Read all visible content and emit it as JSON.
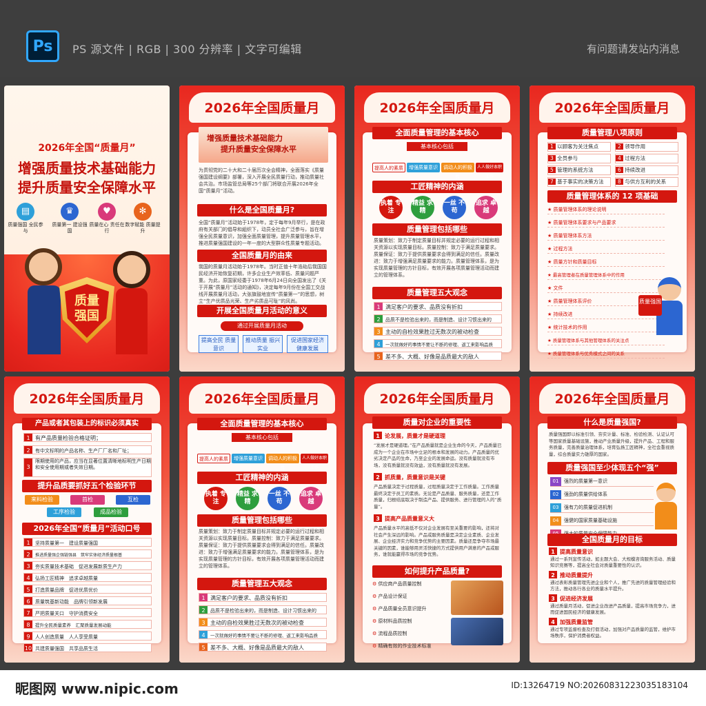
{
  "header": {
    "app_icon_label": "Ps",
    "info": "PS 源文件 | RGB | 300 分辨率 | 文字可编辑",
    "notice": "有问题请发站内消息"
  },
  "footer": {
    "site": "昵图网 www.nipic.com",
    "id": "ID:13264719 NO:20260831223035183104"
  },
  "colors": {
    "brand_red": "#d4170f",
    "ps_blue": "#31a8ff"
  },
  "panel_title": "2026年全国质量月",
  "cover": {
    "line1": "2026年全国“质量月”",
    "line2": "增强质量技术基础能力",
    "line3": "提升质量安全保障水平",
    "icons": [
      {
        "icon": "book-icon",
        "label": "质量强国 全民参与"
      },
      {
        "icon": "trophy-icon",
        "label": "质量第一 建设强国"
      },
      {
        "icon": "heart-icon",
        "label": "质量在心 责任在行"
      },
      {
        "icon": "atom-icon",
        "label": "数字赋能 质量提升"
      }
    ],
    "shield": "质量强国"
  },
  "p2": {
    "banner1": "增强质量技术基础能力",
    "banner2": "提升质量安全保障水平",
    "intro": "为贯彻党的二十大和二十届历次全会精神，全面落实《质量强国建设纲要》部署，深入开展全民质量行动，推动质量社会共治。市场监管总局等25个部门将联合开展2026年全国“质量月”活动。",
    "h1": "什么是全国质量月?",
    "t1": "全国“质量月”活动始于1978年，定于每年9月举行，是在政府有关部门的倡导和組织下，动员全社会广泛参与，旨在增强全民质量意识，加强全面质量管理，提升质量管理水平，推进质量强国建设的一年一度的大型群众性质量专题活动。",
    "h2": "全国质量月的由来",
    "t2": "我国的质量月活动始于1978年。当时正值十年浩劫后我国国民经济开始恢复初期，许多企业生产效率低、质量问题严重。为此，原国家经委于1978年6月24日向全国发出了《关于开展“质量月”活动的通知》，决定每年9月份在全国工交战线开展质量月活动，大张旗鼓地宣传“质量第一”的思想，树立“生产优质品光荣、生产劣质品可耻”的风尚。",
    "h3": "开展全国质量月活动的意义",
    "sub": "通过开展质量月活动",
    "boxes": [
      "提高全民 质量意识",
      "推动质量 振兴实业",
      "促进国家经济 健康发展"
    ]
  },
  "p3": {
    "h1": "全面质量管理的基本核心",
    "core": "基本核心包括",
    "cores": [
      "提高人的素质",
      "增强质量意识",
      "调动人的积极性",
      "人人做好本职工作"
    ],
    "h2": "工匠精神的内涵",
    "circles": [
      "执着 专注",
      "精益 求精",
      "一丝 不苟",
      "追求 卓越"
    ],
    "h3": "质量管理包括哪些",
    "mgmt": "质量策划：致力于制定质量目标并规定必要的运行过程和相关资源以实现质量目标。质量控制：致力于满足质量要求。质量保证：致力于提供质量要求会得到满足的信任。质量改进：致力于增强满足质量要求的能力。质量管理体系，是为实现质量管理的方针目标，有效开展各项质量管理活动而建立的管理体系。",
    "h4": "质量管理五大观念",
    "five": [
      "满足客户的要求、品质没有折扣",
      "品质不是检验出来的，而是制造、设计习惯出来的",
      "主动的自检效果胜过无数次的被动检查",
      "一次就做好的事情不要让不断的修理、返工来影响品质",
      "差不多、大概、好像是品质最大的敌人"
    ]
  },
  "p4": {
    "h1": "质量管理八项原则",
    "eight": [
      "以顾客为关注焦点",
      "领导作用",
      "全员参与",
      "过程方法",
      "管理的系统方法",
      "持续改进",
      "基于事实的决策方法",
      "与供方互利的关系"
    ],
    "h2": "质量管理体系的 12 项基础",
    "twelve": [
      "质量管理体系的理论说明",
      "质量管理体系要求与产品要求",
      "质量管理体系方法",
      "过程方法",
      "质量方针和质量目标",
      "最高管理者在质量管理体系中的作用",
      "文件",
      "质量管理体系评价",
      "持续改进",
      "统计技术的作用",
      "质量管理体系与其他管理体系的关注点",
      "质量管理体系与优秀模式之间的关系"
    ],
    "badge": "质量强国"
  },
  "p5": {
    "h1": "产品或者其包装上的标识必须真实",
    "marks": [
      "有产品质量检验合格证明；",
      "有中文标明的产品名称、生产厂厂名和厂址；",
      "限期使用的产品，应当在显著位置清晰地标明生产日期和安全使用期或者失效日期。"
    ],
    "h2": "提升品质要抓好五个检验环节",
    "checks": [
      "来料检验",
      "首检",
      "互检",
      "工序检验",
      "成品检验"
    ],
    "h3": "2026年全国“质量月”活动口号",
    "slogans": [
      "坚持质量第一　建设质量强国",
      "推进质量强企强链强县　筑牢实体经济质量根基",
      "夯实质量技术基础　促进发展新质生产力",
      "弘扬工匠精神　追求卓越质量",
      "打造质量品牌　促进优质优价",
      "质量筑基新动能　品牌引领新发展",
      "严把质量关口　守护消费安全",
      "提升全民质量素养　汇聚质量发展动能",
      "人人创造质量　人人享受质量",
      "共建质量强国　共享品质生活"
    ]
  },
  "p7": {
    "h1": "质量对企业的重要性",
    "s1": "论发展，质量才是硬道理",
    "t1": "“发展才是硬道理。”在产品质量就是企业生命的今天，产品质量已成为一个企业在市场中立足的根本和发展的动力。产品质量的优劣决定产品的生命，乃至企业的发展命运。没有质量就没有市场，没有质量就没有效益，没有质量就没有发展。",
    "s2": "抓质量，质量意识是关键",
    "t2": "产品质量决定于过程质量，过程质量决定于工作质量。工作质量最终决定于员工的素质。无论是产品质量、服务质量，还是工作质量，归根结底取决于制造产品、提供服务、进行管理的人的“质量”。",
    "s3": "提高产品质量意义大",
    "t3": "产品质量水平的高低不仅对企业发展有至关重要的影响，还将对社会产生深远的影响。产品或服务质量是决定企业素质、企业发展、企业经济实力和竞争优势的主要因素。质量还是争夺市场最关键的因素，谁能够用灵活快捷的方式提供用户满意的产品或服务，谁就能赢得市场的竞争优势。",
    "h2": "如何提升产品质量?",
    "ways": [
      "供应商产品质量控制",
      "产品设计保证",
      "产品质量全员意识提升",
      "原材料品质控制",
      "流程品质控制",
      "精确有效的作业技术标准"
    ]
  },
  "p8": {
    "h1": "什么是质量强国?",
    "t1": "质量强国即以标准引领、夯实计量、标准、检验检测、认证认可等国家质量基础设施，推动产业质量升级，提升产品、工程和服务质量，完善质量治理体系，培育弘扬工匠精神，全社会重视质量，综合质量实力雄厚的国家。",
    "h2": "质量强国至少体现五个“强”",
    "five": [
      {
        "n": "01",
        "t": "强烈的质量第一意识"
      },
      {
        "n": "02",
        "t": "强劲的质量供给体系"
      },
      {
        "n": "03",
        "t": "强有力的质量促进机制"
      },
      {
        "n": "04",
        "t": "强健的国家质量基础设施"
      },
      {
        "n": "05",
        "t": "强大的质量安全保障能力"
      }
    ],
    "h3": "全国质量月的目标",
    "goals": [
      {
        "h": "提高质量意识",
        "t": "通过一系列宣传活动，如主题大会、大规模咨询服务活动、质量知识竞赛等，提高全社会对质量重要性的认识。"
      },
      {
        "h": "推动质量提升",
        "t": "通过表彰质量管理先进企业和个人，推广先进的质量管理经验和方法，推动各行各业的质量水平提升。"
      },
      {
        "h": "促进经济发展",
        "t": "通过质量月活动，促进企业改进产品质量，提高市场竞争力，进而促进国民经济的健康发展。"
      },
      {
        "h": "加强质量监管",
        "t": "通过专项监督检查及打假活动，加强对产品质量的监管，维护市场秩序，保护消费者权益。"
      }
    ]
  }
}
